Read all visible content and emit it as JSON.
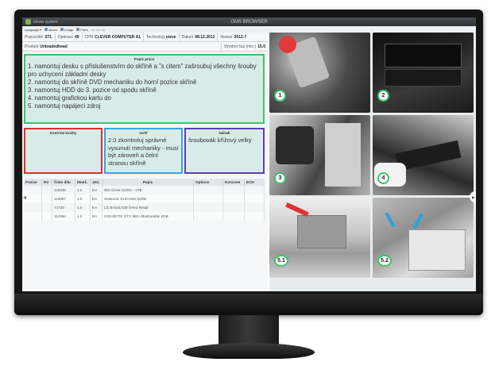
{
  "app": {
    "brand": "clever system",
    "window_title": "GMS BROWSER"
  },
  "toolbar": {
    "items": [
      "Language",
      "Above",
      "Image",
      "Parts"
    ]
  },
  "info": {
    "pracoviste_label": "Pracoviště",
    "pracoviste_value": "STL",
    "operace_label": "Operace",
    "operace_value": "49",
    "cpn_label": "CPN",
    "cpn_value": "CLEVER COMPUTER A1",
    "technolog_label": "Technolog",
    "technolog_value": "steve",
    "datum_label": "Datum",
    "datum_value": "08.12.2012",
    "revize_label": "Revize",
    "revize_value": "2012-7",
    "produkt_label": "Produkt",
    "produkt_value": "Unloadedhead",
    "cas_label": "Výrobní čas (min.)",
    "cas_value": "15.0"
  },
  "work": {
    "header": "Popis práce",
    "text": "1. namontuj desku s příslušenstvím do skříně a \"s citem\" zašroubuj všechny šrouby pro uchycení základní desky\n2. namontuj do skříně DVD mechaniku do horní pozice skříně\n3. namontuj HDD do 3. pozice od spodu skříně\n4. namontuj grafickou kartu do\n5. namontuj napájecí zdroj"
  },
  "quality": {
    "header": "Kontrola kvality",
    "text": ""
  },
  "check": {
    "header": "Ověř",
    "text": "2.0 zkontroluj správné vysunutí mechaniky - musí být zároveň a čelní stranou skříně"
  },
  "tools": {
    "header": "Nářadí",
    "text": "šroubovák křížový velký"
  },
  "table": {
    "columns": [
      "Pozice",
      "NV",
      "Číslo dílu",
      "Množ.",
      "Jed.",
      "Popis",
      "Options",
      "Koncvse",
      "ECN"
    ],
    "rows": [
      [
        "",
        "",
        "115539",
        "1.0",
        "EA",
        "WD Green EZRX - 3TB",
        "",
        "",
        ""
      ],
      [
        "",
        "",
        "116967",
        "1.0",
        "EA",
        "Seasonic S12II-520 520W",
        "",
        "",
        ""
      ],
      [
        "",
        "",
        "74748",
        "1.0",
        "EA",
        "LG BH10LS38 černá Retail",
        "",
        "",
        ""
      ],
      [
        "",
        "",
        "114364",
        "1.0",
        "EA",
        "GIGABYTE GTX 660 UltraDurable 2GB",
        "",
        "",
        ""
      ]
    ]
  },
  "photos": [
    {
      "badge": "1"
    },
    {
      "badge": "2"
    },
    {
      "badge": "3"
    },
    {
      "badge": "4"
    },
    {
      "badge": "5.1"
    },
    {
      "badge": "5.2"
    }
  ],
  "colors": {
    "work_border": "#3cc46e",
    "quality_border": "#e22d2d",
    "check_border": "#3aa3e3",
    "tools_border": "#5b3fb0",
    "box_fill": "#d9ebe7"
  }
}
